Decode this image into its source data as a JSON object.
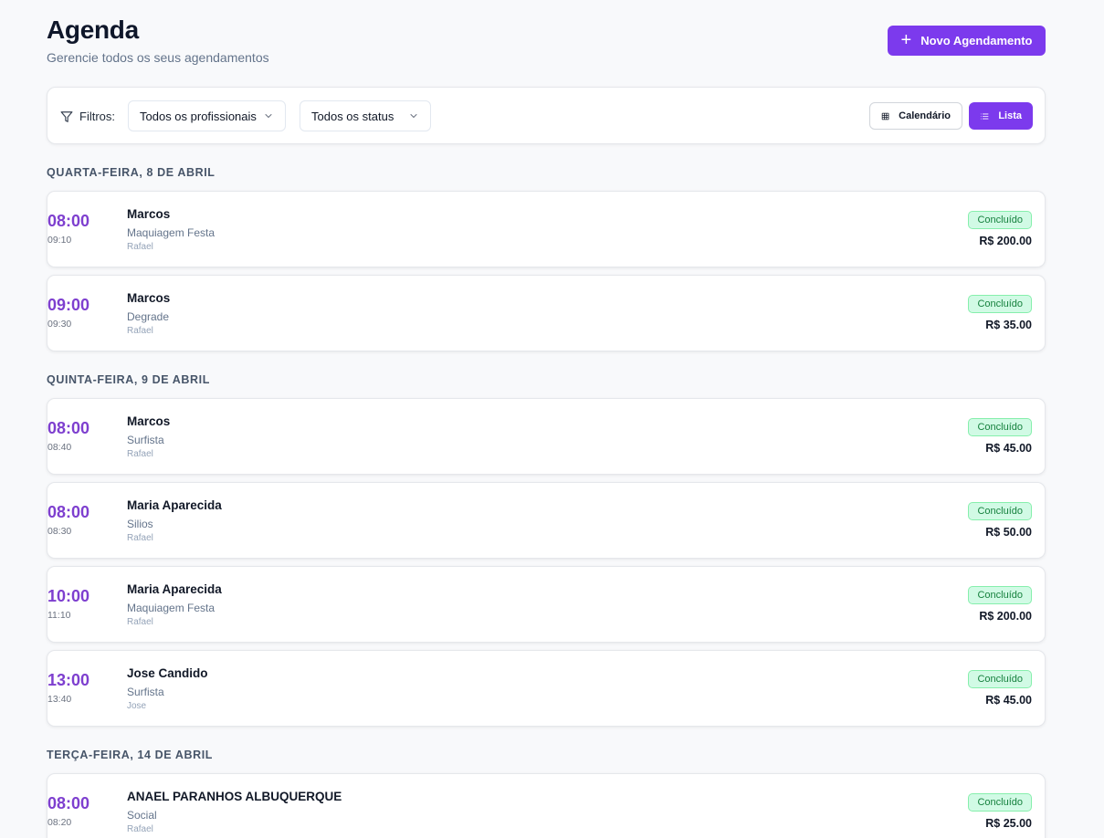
{
  "header": {
    "title": "Agenda",
    "subtitle": "Gerencie todos os seus agendamentos",
    "new_button": "Novo Agendamento"
  },
  "filters": {
    "label": "Filtros:",
    "professional_select": "Todos os profissionais",
    "status_select": "Todos os status",
    "view_calendar": "Calendário",
    "view_list": "Lista",
    "active_view": "Lista"
  },
  "colors": {
    "accent": "#7c3aed",
    "time": "#7e3fcf",
    "badge_bg": "#d1fae5",
    "badge_text": "#15803d"
  },
  "days": [
    {
      "heading": "QUARTA-FEIRA, 8 DE ABRIL",
      "appointments": [
        {
          "start": "08:00",
          "end": "09:10",
          "client": "Marcos",
          "service": "Maquiagem Festa",
          "professional": "Rafael",
          "status": "Concluído",
          "price": "R$ 200.00"
        },
        {
          "start": "09:00",
          "end": "09:30",
          "client": "Marcos",
          "service": "Degrade",
          "professional": "Rafael",
          "status": "Concluído",
          "price": "R$ 35.00"
        }
      ]
    },
    {
      "heading": "QUINTA-FEIRA, 9 DE ABRIL",
      "appointments": [
        {
          "start": "08:00",
          "end": "08:40",
          "client": "Marcos",
          "service": "Surfista",
          "professional": "Rafael",
          "status": "Concluído",
          "price": "R$ 45.00"
        },
        {
          "start": "08:00",
          "end": "08:30",
          "client": "Maria Aparecida",
          "service": "Silios",
          "professional": "Rafael",
          "status": "Concluído",
          "price": "R$ 50.00"
        },
        {
          "start": "10:00",
          "end": "11:10",
          "client": "Maria Aparecida",
          "service": "Maquiagem Festa",
          "professional": "Rafael",
          "status": "Concluído",
          "price": "R$ 200.00"
        },
        {
          "start": "13:00",
          "end": "13:40",
          "client": "Jose Candido",
          "service": "Surfista",
          "professional": "Jose",
          "status": "Concluído",
          "price": "R$ 45.00"
        }
      ]
    },
    {
      "heading": "TERÇA-FEIRA, 14 DE ABRIL",
      "appointments": [
        {
          "start": "08:00",
          "end": "08:20",
          "client": "ANAEL PARANHOS ALBUQUERQUE",
          "service": "Social",
          "professional": "Rafael",
          "status": "Concluído",
          "price": "R$ 25.00"
        }
      ]
    }
  ]
}
